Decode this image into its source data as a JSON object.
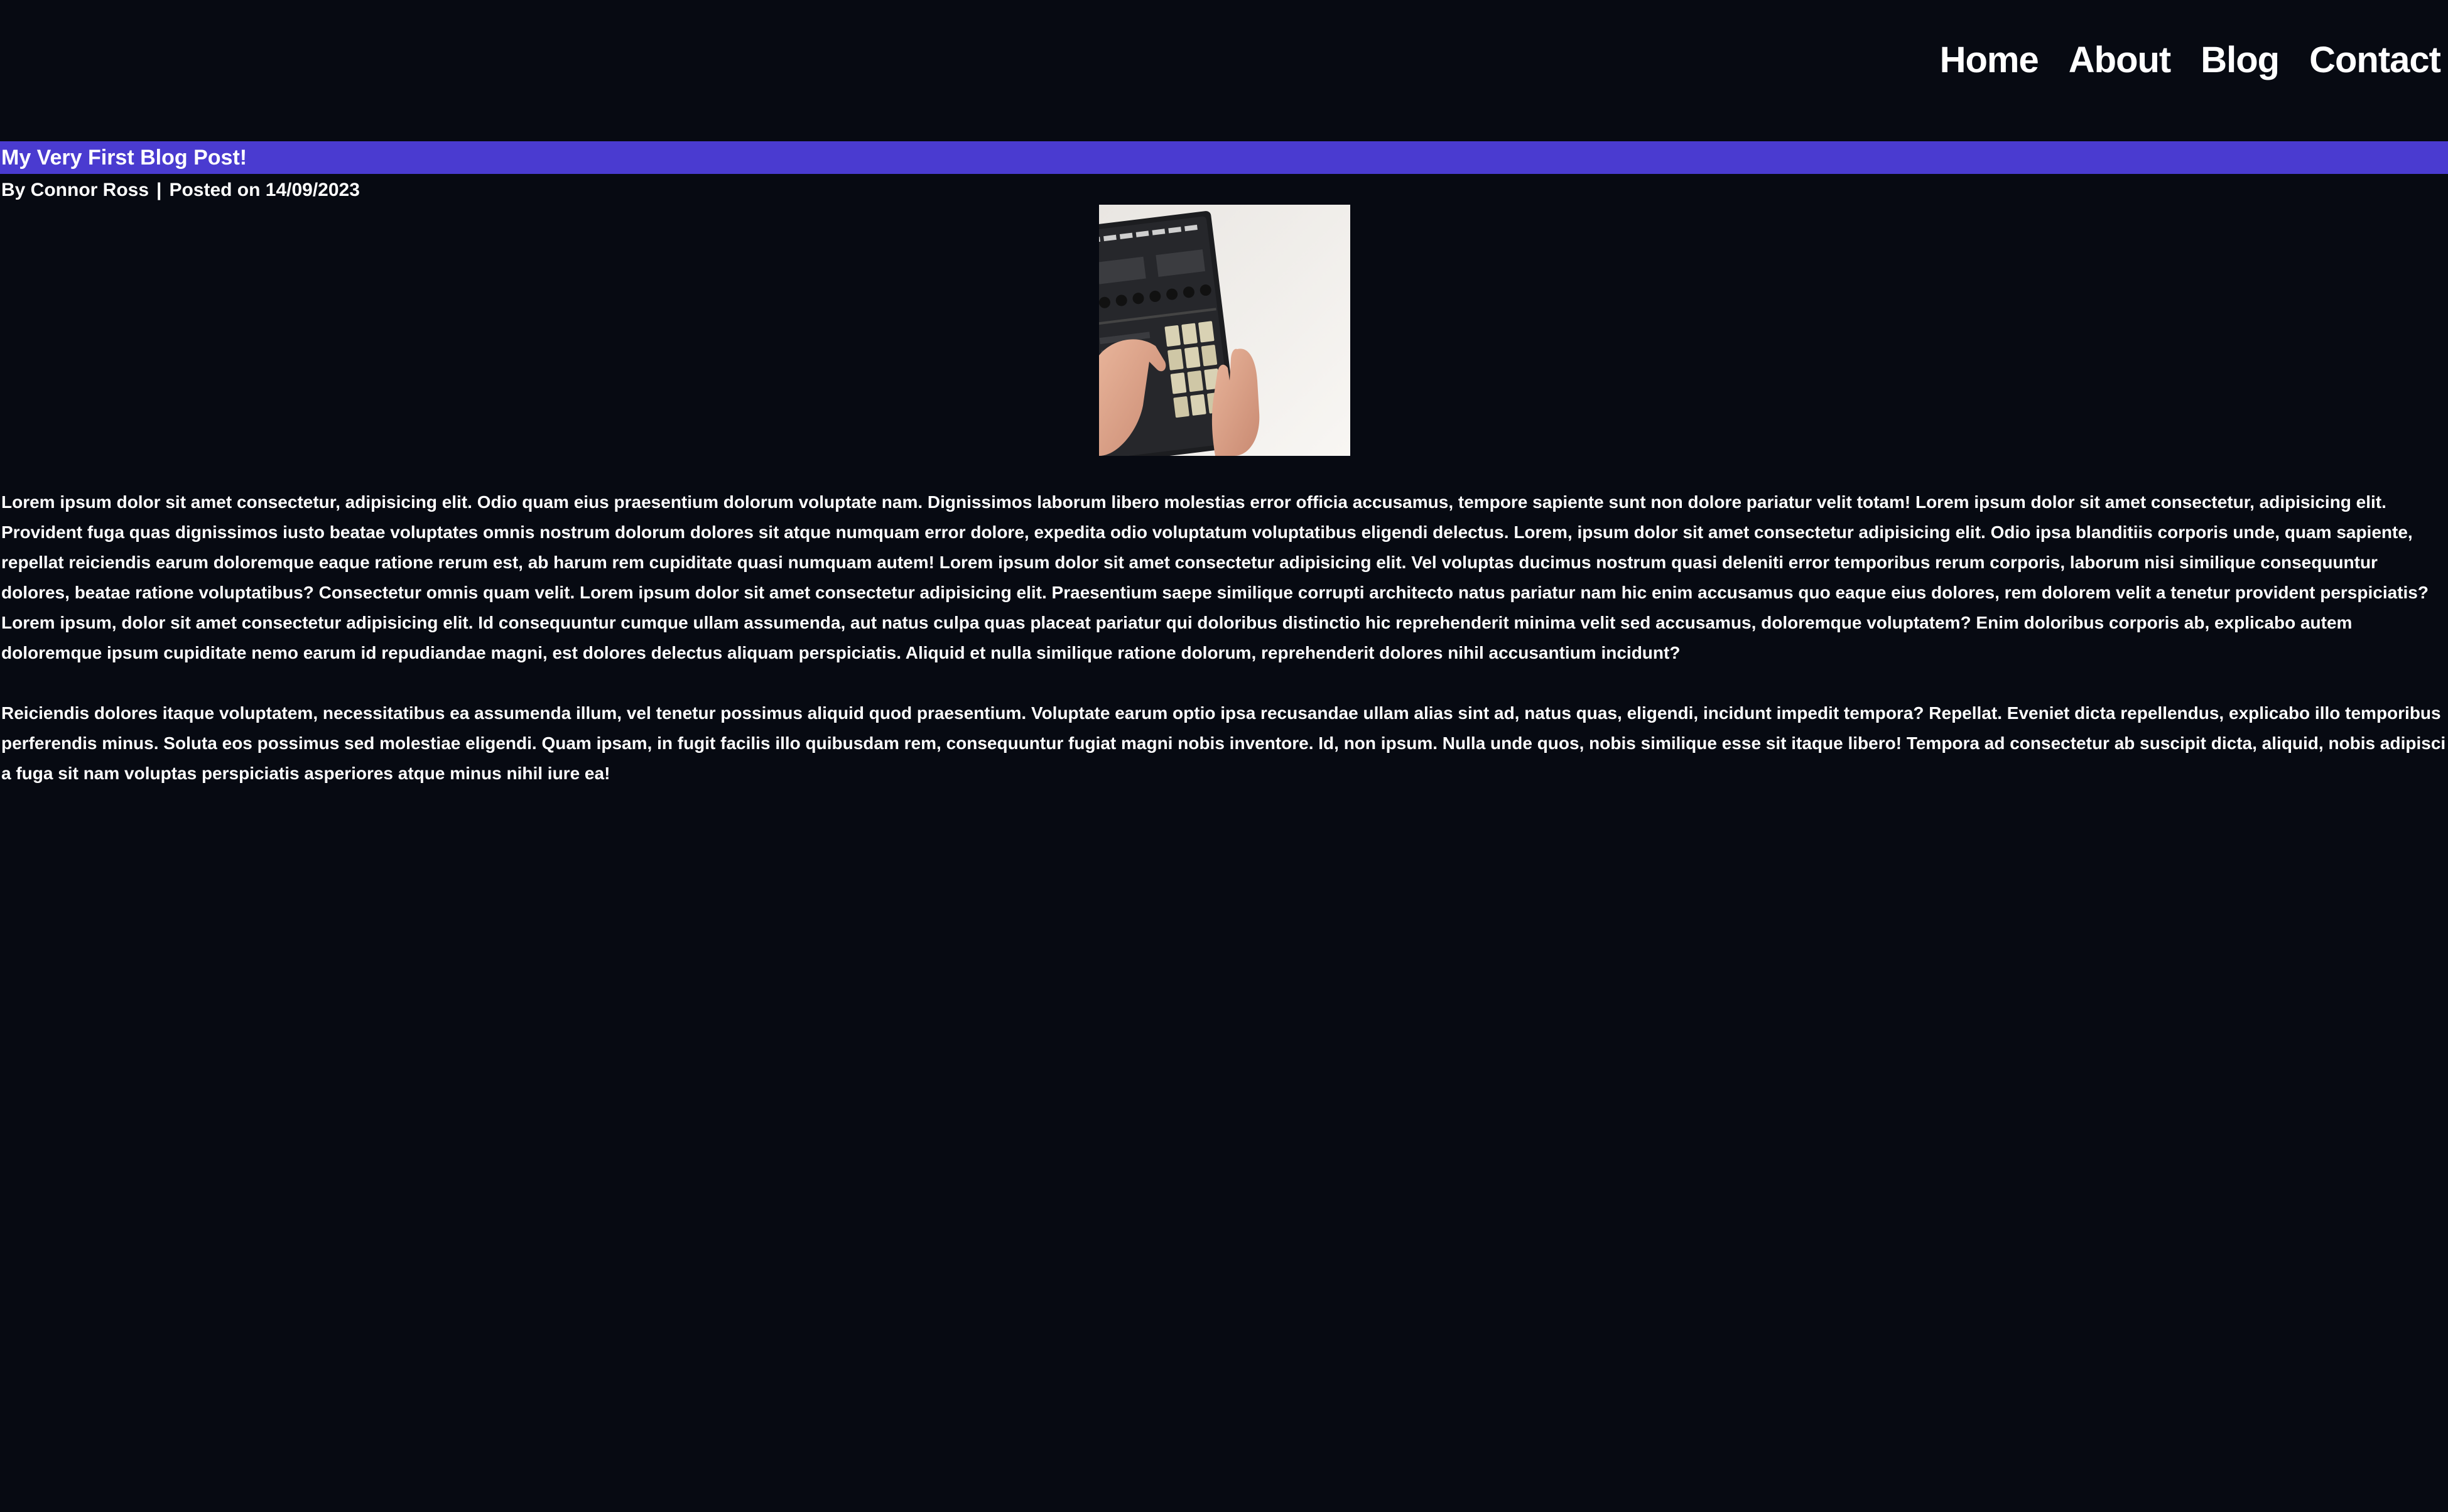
{
  "nav": {
    "items": [
      "Home",
      "About",
      "Blog",
      "Contact"
    ]
  },
  "post": {
    "title": "My Very First Blog Post!",
    "author": "By Connor Ross",
    "separator": "|",
    "posted": "Posted on 14/09/2023",
    "image_alt": "Hands playing a drum pad controller",
    "paragraphs": [
      "Lorem ipsum dolor sit amet consectetur, adipisicing elit. Odio quam eius praesentium dolorum voluptate nam. Dignissimos laborum libero molestias error officia accusamus, tempore sapiente sunt non dolore pariatur velit totam! Lorem ipsum dolor sit amet consectetur, adipisicing elit. Provident fuga quas dignissimos iusto beatae voluptates omnis nostrum dolorum dolores sit atque numquam error dolore, expedita odio voluptatum voluptatibus eligendi delectus. Lorem, ipsum dolor sit amet consectetur adipisicing elit. Odio ipsa blanditiis corporis unde, quam sapiente, repellat reiciendis earum doloremque eaque ratione rerum est, ab harum rem cupiditate quasi numquam autem! Lorem ipsum dolor sit amet consectetur adipisicing elit. Vel voluptas ducimus nostrum quasi deleniti error temporibus rerum corporis, laborum nisi similique consequuntur dolores, beatae ratione voluptatibus? Consectetur omnis quam velit. Lorem ipsum dolor sit amet consectetur adipisicing elit. Praesentium saepe similique corrupti architecto natus pariatur nam hic enim accusamus quo eaque eius dolores, rem dolorem velit a tenetur provident perspiciatis? Lorem ipsum, dolor sit amet consectetur adipisicing elit. Id consequuntur cumque ullam assumenda, aut natus culpa quas placeat pariatur qui doloribus distinctio hic reprehenderit minima velit sed accusamus, doloremque voluptatem? Enim doloribus corporis ab, explicabo autem doloremque ipsum cupiditate nemo earum id repudiandae magni, est dolores delectus aliquam perspiciatis. Aliquid et nulla similique ratione dolorum, reprehenderit dolores nihil accusantium incidunt?",
      "Reiciendis dolores itaque voluptatem, necessitatibus ea assumenda illum, vel tenetur possimus aliquid quod praesentium. Voluptate earum optio ipsa recusandae ullam alias sint ad, natus quas, eligendi, incidunt impedit tempora? Repellat. Eveniet dicta repellendus, explicabo illo temporibus perferendis minus. Soluta eos possimus sed molestiae eligendi. Quam ipsam, in fugit facilis illo quibusdam rem, consequuntur fugiat magni nobis inventore. Id, non ipsum. Nulla unde quos, nobis similique esse sit itaque libero! Tempora ad consectetur ab suscipit dicta, aliquid, nobis adipisci a fuga sit nam voluptas perspiciatis asperiores atque minus nihil iure ea!"
    ]
  },
  "colors": {
    "background": "#070a12",
    "title_bar": "#4a3bd0",
    "text": "#ffffff"
  }
}
